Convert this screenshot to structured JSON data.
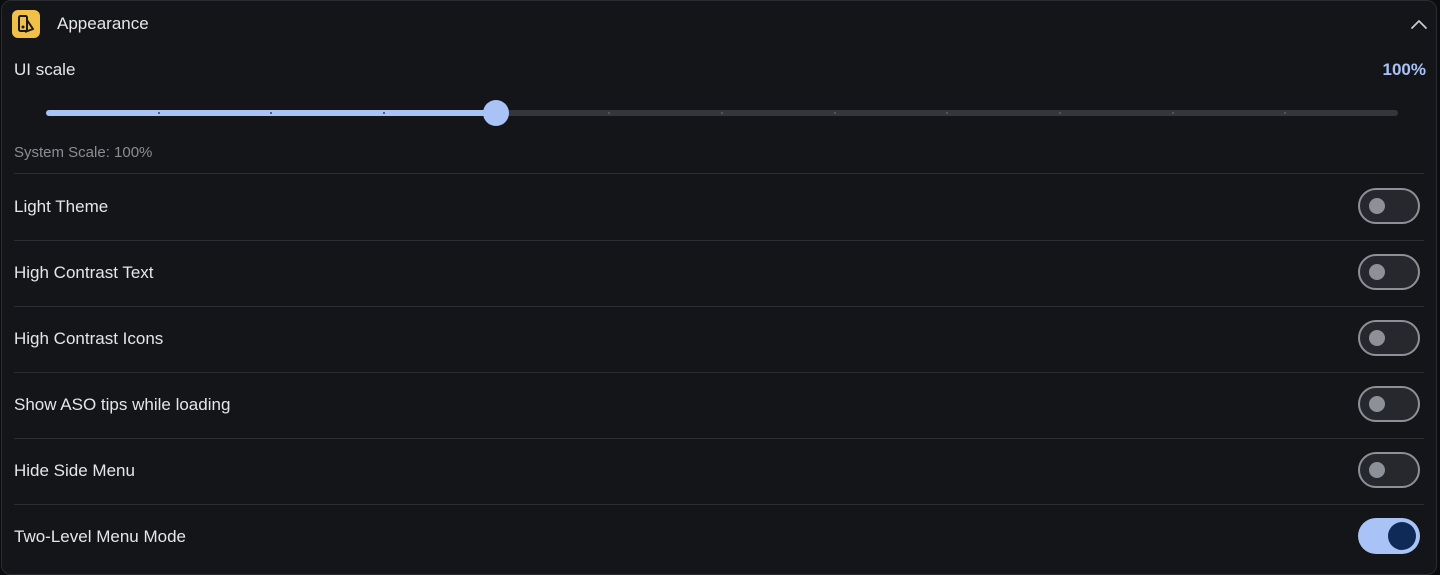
{
  "header": {
    "title": "Appearance",
    "icon": "appearance-app-icon",
    "collapse_icon": "chevron-up-icon"
  },
  "ui_scale": {
    "label": "UI scale",
    "value_text": "100%",
    "slider_value_fraction": 0.333,
    "tick_count": 13,
    "system_scale_text": "System Scale: 100%"
  },
  "settings": [
    {
      "label": "Light Theme",
      "on": false
    },
    {
      "label": "High Contrast Text",
      "on": false
    },
    {
      "label": "High Contrast Icons",
      "on": false
    },
    {
      "label": "Show ASO tips while loading",
      "on": false
    },
    {
      "label": "Hide Side Menu",
      "on": false
    },
    {
      "label": "Two-Level Menu Mode",
      "on": true
    }
  ],
  "colors": {
    "accent": "#a9c3f7",
    "background": "#141519",
    "icon_bg": "#f0c048",
    "toggle_knob_on": "#102a57"
  }
}
